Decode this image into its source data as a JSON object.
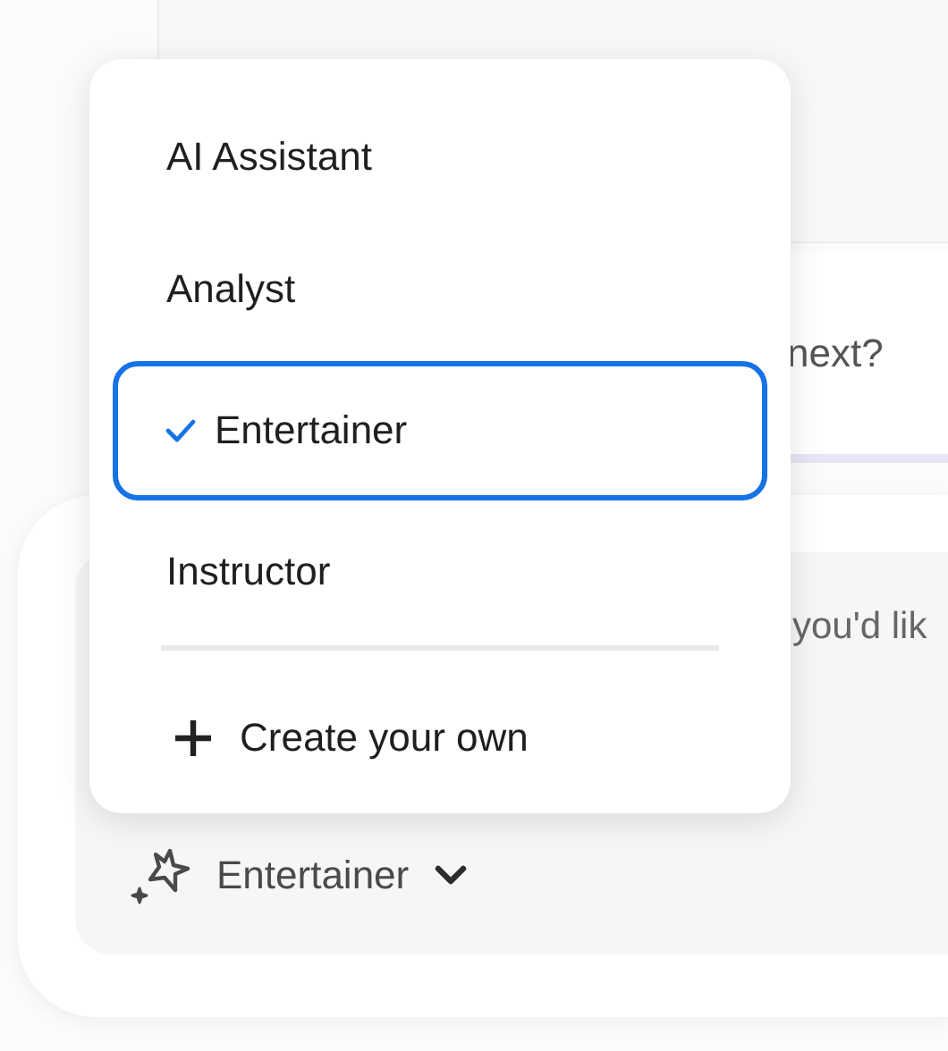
{
  "message": {
    "text": "next?"
  },
  "composer": {
    "placeholder": "you'd lik",
    "persona_button": {
      "label": "Entertainer"
    }
  },
  "persona_menu": {
    "items": [
      {
        "label": "AI Assistant",
        "selected": false
      },
      {
        "label": "Analyst",
        "selected": false
      },
      {
        "label": "Entertainer",
        "selected": true
      },
      {
        "label": "Instructor",
        "selected": false
      }
    ],
    "create_action": "Create your own"
  }
}
